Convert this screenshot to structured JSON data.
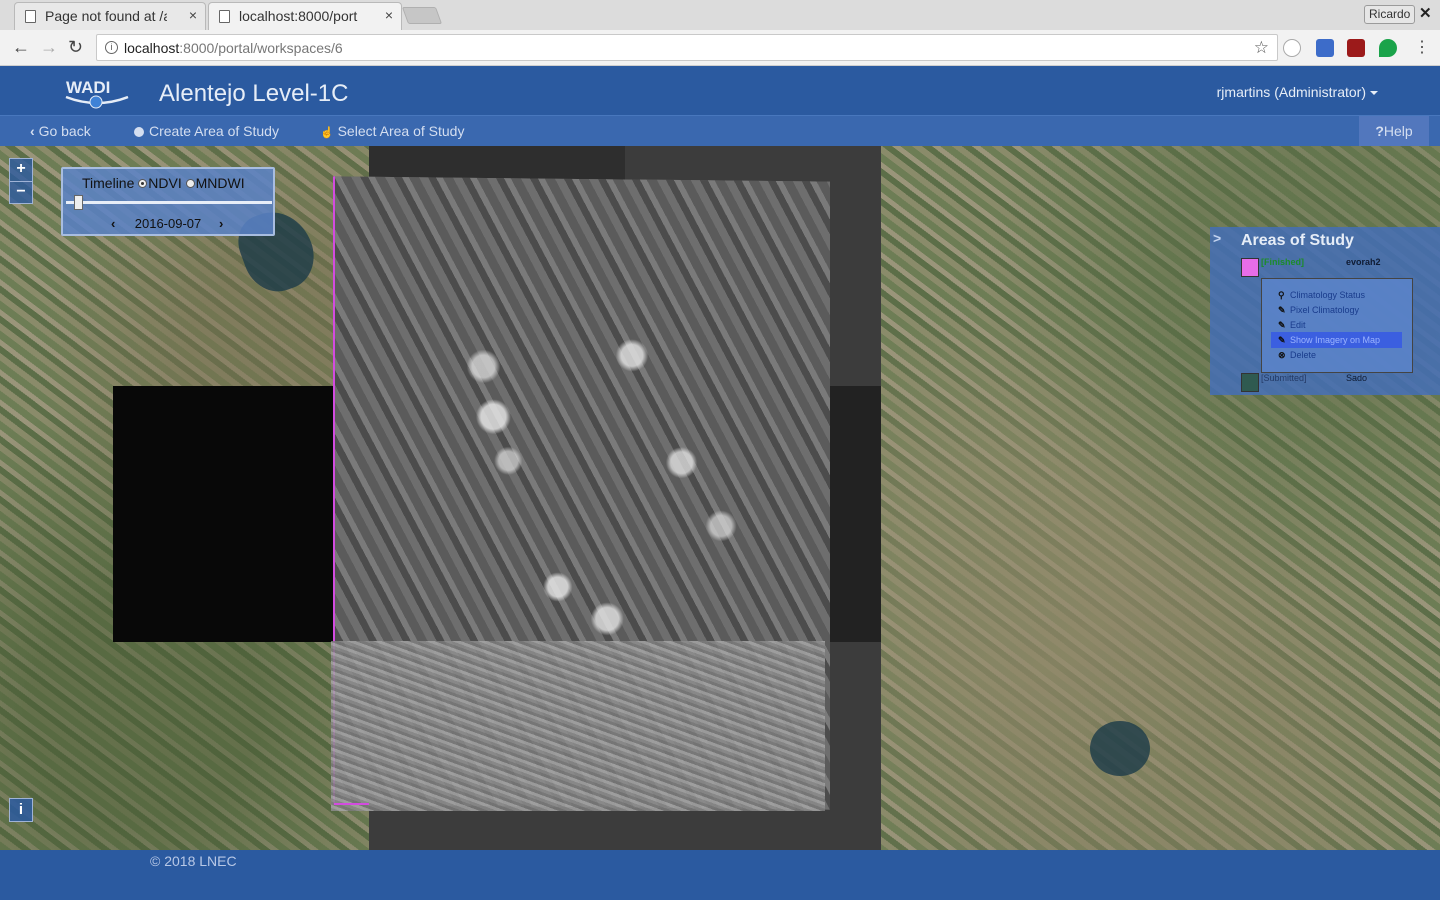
{
  "browser": {
    "tabs": [
      {
        "title": "Page not found at /a",
        "close": "×"
      },
      {
        "title": "localhost:8000/port",
        "close": "×"
      }
    ],
    "profile_name": "Ricardo",
    "window_close": "✕",
    "url_host": "localhost",
    "url_rest": ":8000/portal/workspaces/6",
    "nav": {
      "back": "←",
      "forward": "→",
      "reload": "↻"
    },
    "bookmark_star": "☆"
  },
  "header": {
    "logo_text": "WADI",
    "title": "Alentejo Level-1C",
    "user": "rjmartins (Administrator)"
  },
  "subnav": {
    "go_back": "Go back",
    "create_area": "Create Area of Study",
    "select_area": "Select Area of Study",
    "help": "Help"
  },
  "map": {
    "zoom_in": "+",
    "zoom_out": "−",
    "info": "i",
    "timeline": {
      "label": "Timeline",
      "options": [
        "NDVI",
        "MNDWI"
      ],
      "selected": "NDVI",
      "date": "2016-09-07",
      "prev": "‹",
      "next": "›"
    }
  },
  "areas_of_study": {
    "title": "Areas of Study",
    "collapse": ">",
    "items": [
      {
        "status": "[Finished]",
        "name": "evorah2",
        "color": "#e86de8"
      },
      {
        "status": "[Submitted]",
        "name": "Sado",
        "color": "#2f5a50"
      }
    ],
    "menu": [
      {
        "label": "Climatology Status",
        "icon": "search-icon",
        "glyph": "⚲"
      },
      {
        "label": "Pixel Climatology",
        "icon": "pencil-icon",
        "glyph": "✎"
      },
      {
        "label": "Edit",
        "icon": "pencil-icon",
        "glyph": "✎"
      },
      {
        "label": "Show Imagery on Map",
        "icon": "pencil-icon",
        "glyph": "✎"
      },
      {
        "label": "Delete",
        "icon": "delete-icon",
        "glyph": "⊗"
      }
    ]
  },
  "footer": {
    "copyright": "© 2018 LNEC"
  }
}
